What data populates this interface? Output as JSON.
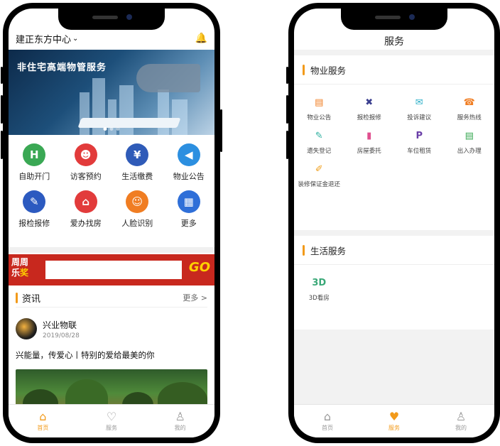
{
  "left": {
    "location": "建正东方中心",
    "banner_title": "非住宅高端物管服务",
    "grid": [
      {
        "label": "自助开门",
        "color": "#3aa854",
        "glyph": "H",
        "icon": "door-icon"
      },
      {
        "label": "访客预约",
        "color": "#e23b3b",
        "glyph": "☻",
        "icon": "visitor-icon"
      },
      {
        "label": "生活缴费",
        "color": "#2f5bb8",
        "glyph": "¥",
        "icon": "payment-icon"
      },
      {
        "label": "物业公告",
        "color": "#2c8fe0",
        "glyph": "◀",
        "icon": "megaphone-icon"
      },
      {
        "label": "报检报修",
        "color": "#2c5ac0",
        "glyph": "✎",
        "icon": "wrench-icon"
      },
      {
        "label": "爱办找房",
        "color": "#e23b3b",
        "glyph": "⌂",
        "icon": "house-icon"
      },
      {
        "label": "人脸识别",
        "color": "#f07d22",
        "glyph": "☺",
        "icon": "face-id-icon"
      },
      {
        "label": "更多",
        "color": "#2f6fd8",
        "glyph": "▦",
        "icon": "more-grid-icon"
      }
    ],
    "promo": {
      "line1": "周周",
      "line2a": "乐",
      "line2b": "奖",
      "go": "GO"
    },
    "news": {
      "title": "资讯",
      "more": "更多 >",
      "author": "兴业物联",
      "date": "2019/08/28",
      "text": "兴能量，传爱心丨特别的爱给最美的你"
    },
    "tabs": [
      {
        "label": "首页",
        "icon": "home-icon",
        "glyph": "⌂",
        "active": true
      },
      {
        "label": "服务",
        "icon": "heart-icon",
        "glyph": "♡",
        "active": false
      },
      {
        "label": "我的",
        "icon": "user-icon",
        "glyph": "♙",
        "active": false
      }
    ]
  },
  "right": {
    "title": "服务",
    "property_section": "物业服务",
    "property_items": [
      {
        "label": "物业公告",
        "glyph": "▤",
        "color": "#f07d22",
        "icon": "notice-icon"
      },
      {
        "label": "报检报修",
        "glyph": "✖",
        "color": "#3b3f8f",
        "icon": "tools-icon"
      },
      {
        "label": "投诉建议",
        "glyph": "✉",
        "color": "#2fb0c9",
        "icon": "message-icon"
      },
      {
        "label": "服务热线",
        "glyph": "☎",
        "color": "#f07d22",
        "icon": "phone-icon"
      },
      {
        "label": "遗失登记",
        "glyph": "✎",
        "color": "#2fb0a0",
        "icon": "lost-item-icon"
      },
      {
        "label": "房屋委托",
        "glyph": "▮",
        "color": "#e0508f",
        "icon": "building-icon"
      },
      {
        "label": "车位租赁",
        "glyph": "P",
        "color": "#6a3fa8",
        "icon": "parking-icon"
      },
      {
        "label": "出入办理",
        "glyph": "▤",
        "color": "#3aa854",
        "icon": "pass-icon"
      },
      {
        "label": "装修保证金退还",
        "glyph": "✐",
        "color": "#f0a020",
        "icon": "renovation-icon"
      }
    ],
    "life_section": "生活服务",
    "life_items": [
      {
        "label": "3D看房",
        "glyph": "3D",
        "color": "#3aa878",
        "icon": "3d-view-icon"
      }
    ],
    "tabs": [
      {
        "label": "首页",
        "icon": "home-icon",
        "glyph": "⌂",
        "active": false
      },
      {
        "label": "服务",
        "icon": "heart-icon",
        "glyph": "♥",
        "active": true
      },
      {
        "label": "我的",
        "icon": "user-icon",
        "glyph": "♙",
        "active": false
      }
    ]
  },
  "colors": {
    "accent": "#f29a1a",
    "inactive": "#999999"
  }
}
